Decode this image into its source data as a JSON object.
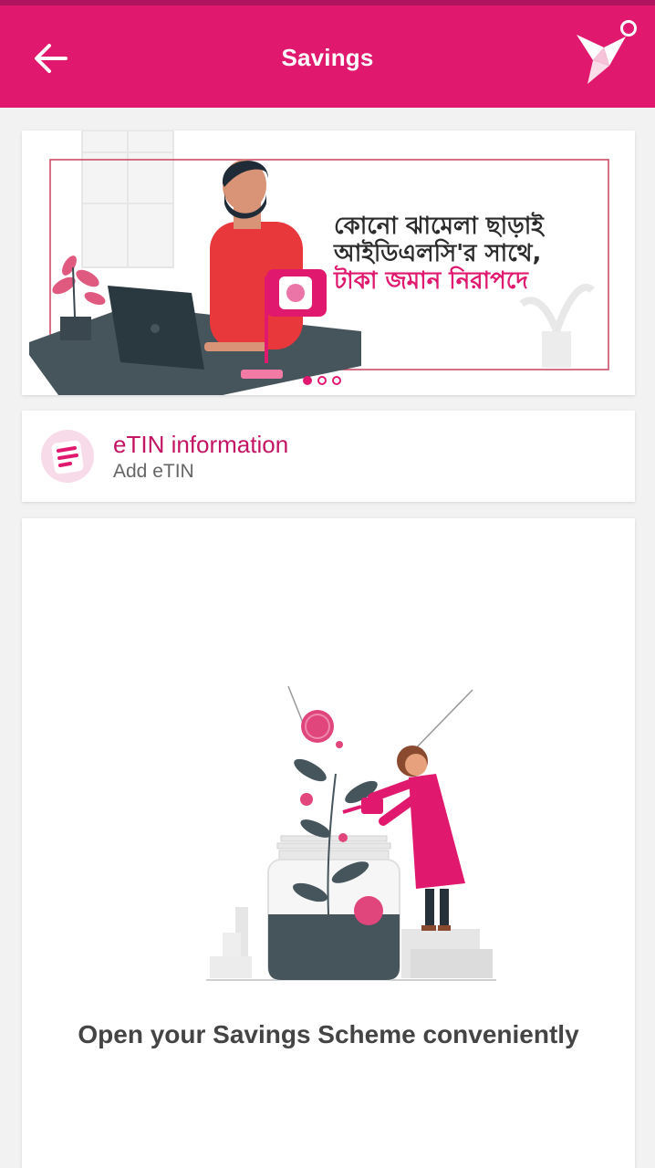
{
  "header": {
    "title": "Savings",
    "back_icon": "arrow-left-icon",
    "logo_icon": "origami-bird-icon",
    "brand_color": "#e0196e"
  },
  "banner": {
    "line1": "কোনো ঝামেলা ছাড়াই",
    "line2": "আইডিএলসি'র সাথে,",
    "line3": "টাকা জমান নিরাপদে",
    "slides": 3,
    "active_slide": 1
  },
  "etin": {
    "title": "eTIN information",
    "subtitle": "Add eTIN",
    "icon": "document-lines-icon"
  },
  "promo": {
    "caption": "Open your Savings Scheme conveniently"
  }
}
